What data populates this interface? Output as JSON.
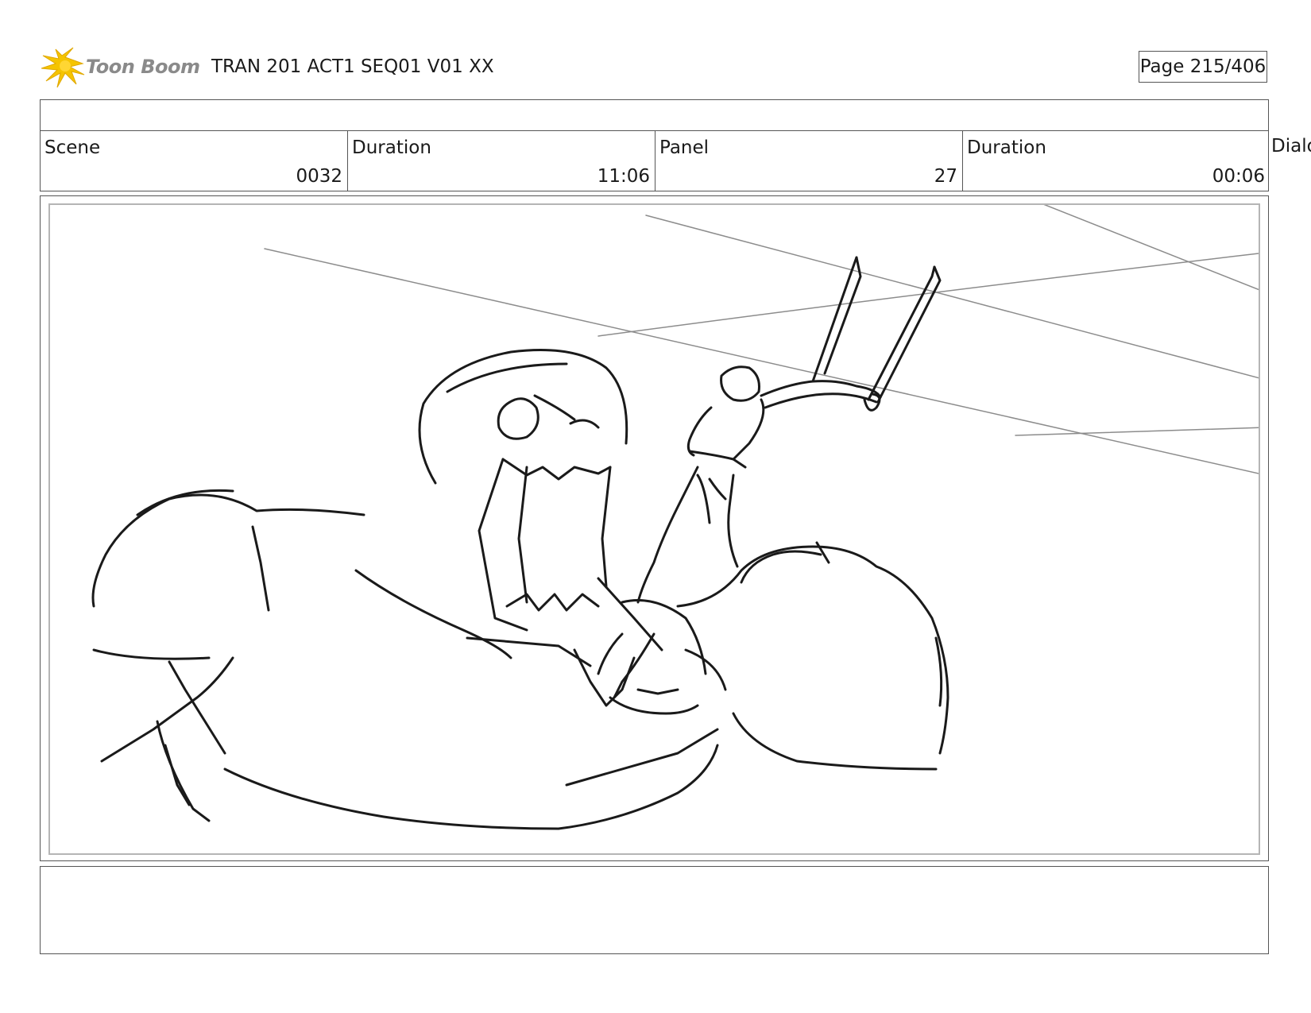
{
  "header": {
    "logo_text": "Toon Boom",
    "title": "TRAN 201 ACT1 SEQ01 V01 XX",
    "page": "Page 215/406"
  },
  "info": {
    "scene_label": "Scene",
    "scene_value": "0032",
    "scene_duration_label": "Duration",
    "scene_duration_value": "11:06",
    "panel_label": "Panel",
    "panel_value": "27",
    "panel_duration_label": "Duration",
    "panel_duration_value": "00:06",
    "dialogue_label": "Dialo"
  },
  "colors": {
    "logo_star": "#f5c400",
    "logo_text": "#8a8a8a",
    "frame_border": "#555555",
    "inner_frame": "#b5b5b5",
    "sketch_ink": "#1a1a1a",
    "sketch_guides": "#8c8c8c"
  }
}
